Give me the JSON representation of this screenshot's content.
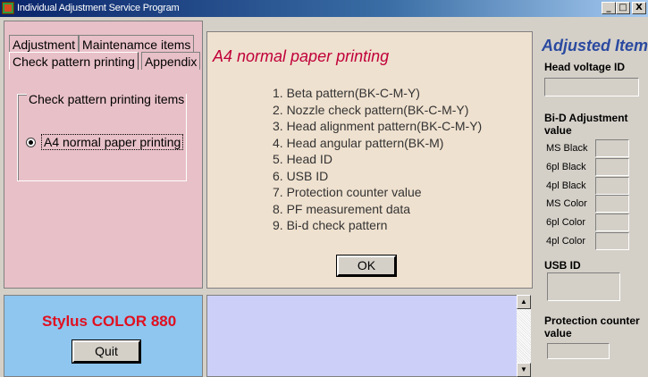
{
  "window": {
    "title": "Individual Adjustment Service Program",
    "controls": [
      "_",
      "□",
      "X"
    ]
  },
  "tabs": {
    "row1": [
      "Adjustment",
      "Maintenamce items"
    ],
    "row2": [
      "Check pattern printing",
      "Appendix"
    ]
  },
  "group": {
    "title": "Check pattern printing items",
    "option_label": "A4 normal paper printing",
    "option_selected": true
  },
  "center": {
    "title": "A4 normal paper printing",
    "items": [
      "1. Beta pattern(BK-C-M-Y)",
      "2. Nozzle check pattern(BK-C-M-Y)",
      "3. Head alignment pattern(BK-C-M-Y)",
      "4. Head angular pattern(BK-M)",
      "5. Head ID",
      "6. USB  ID",
      "7. Protection counter value",
      "8. PF measurement data",
      "9. Bi-d check pattern"
    ],
    "ok_label": "OK"
  },
  "right": {
    "title": "Adjusted Item",
    "head_voltage_label": "Head voltage ID",
    "bid_label_1": "Bi-D Adjustment",
    "bid_label_2": "value",
    "bid_rows": [
      "MS Black",
      "6pl Black",
      "4pl Black",
      "MS Color",
      "6pl Color",
      "4pl Color"
    ],
    "usb_label": "USB ID",
    "protection_label_1": "Protection counter",
    "protection_label_2": "value"
  },
  "model": {
    "name": "Stylus COLOR 880",
    "quit_label": "Quit"
  }
}
